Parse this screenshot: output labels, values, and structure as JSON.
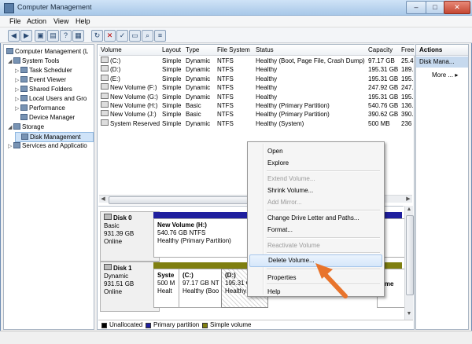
{
  "window": {
    "title": "Computer Management",
    "controls": [
      "–",
      "□",
      "✕"
    ]
  },
  "menu": [
    "File",
    "Action",
    "View",
    "Help"
  ],
  "tree": [
    {
      "label": "Computer Management (L",
      "level": 0
    },
    {
      "label": "System Tools",
      "level": 1
    },
    {
      "label": "Task Scheduler",
      "level": 2
    },
    {
      "label": "Event Viewer",
      "level": 2
    },
    {
      "label": "Shared Folders",
      "level": 2
    },
    {
      "label": "Local Users and Gro",
      "level": 2
    },
    {
      "label": "Performance",
      "level": 2
    },
    {
      "label": "Device Manager",
      "level": 2
    },
    {
      "label": "Storage",
      "level": 1
    },
    {
      "label": "Disk Management",
      "level": 2
    },
    {
      "label": "Services and Applicatio",
      "level": 1
    }
  ],
  "volumes": {
    "headers": [
      "Volume",
      "Layout",
      "Type",
      "File System",
      "Status",
      "Capacity",
      "Free"
    ],
    "rows": [
      [
        "(C:)",
        "Simple",
        "Dynamic",
        "NTFS",
        "Healthy (Boot, Page File, Crash Dump)",
        "97.17 GB",
        "25.4"
      ],
      [
        "(D:)",
        "Simple",
        "Dynamic",
        "NTFS",
        "Healthy",
        "195.31 GB",
        "189."
      ],
      [
        "(E:)",
        "Simple",
        "Dynamic",
        "NTFS",
        "Healthy",
        "195.31 GB",
        "195."
      ],
      [
        "New Volume (F:)",
        "Simple",
        "Dynamic",
        "NTFS",
        "Healthy",
        "247.92 GB",
        "247."
      ],
      [
        "New Volume (G:)",
        "Simple",
        "Dynamic",
        "NTFS",
        "Healthy",
        "195.31 GB",
        "195."
      ],
      [
        "New Volume (H:)",
        "Simple",
        "Basic",
        "NTFS",
        "Healthy (Primary Partition)",
        "540.76 GB",
        "136."
      ],
      [
        "New Volume (J:)",
        "Simple",
        "Basic",
        "NTFS",
        "Healthy (Primary Partition)",
        "390.62 GB",
        "390."
      ],
      [
        "System Reserved",
        "Simple",
        "Dynamic",
        "NTFS",
        "Healthy (System)",
        "500 MB",
        "236"
      ]
    ]
  },
  "disks": [
    {
      "name": "Disk 0",
      "type": "Basic",
      "size": "931.39 GB",
      "state": "Online",
      "partitions": [
        {
          "title": "New Volume  (H:)",
          "line2": "540.76 GB NTFS",
          "line3": "Healthy (Primary Partition)"
        }
      ]
    },
    {
      "name": "Disk 1",
      "type": "Dynamic",
      "size": "931.51 GB",
      "state": "Online",
      "partitions": [
        {
          "title": "Syste",
          "line2": "500 M",
          "line3": "Healt"
        },
        {
          "title": "(C:)",
          "line2": "97.17 GB NT",
          "line3": "Healthy (Boo"
        },
        {
          "title": "(D:)",
          "line2": "195.31 GB",
          "line3": "Healthy"
        },
        {
          "title": "ume",
          "line2": "",
          "line3": ""
        }
      ]
    }
  ],
  "legend": [
    {
      "label": "Unallocated",
      "color": "#000000"
    },
    {
      "label": "Primary partition",
      "color": "#1f1f9e"
    },
    {
      "label": "Simple volume",
      "color": "#7f7f10"
    }
  ],
  "actions": {
    "header": "Actions",
    "selected": "Disk Mana...",
    "more": "More ..."
  },
  "context_menu": [
    {
      "label": "Open",
      "enabled": true
    },
    {
      "label": "Explore",
      "enabled": true
    },
    {
      "label": "Extend Volume...",
      "enabled": false
    },
    {
      "label": "Shrink Volume...",
      "enabled": true
    },
    {
      "label": "Add Mirror...",
      "enabled": false
    },
    {
      "label": "Change Drive Letter and Paths...",
      "enabled": true
    },
    {
      "label": "Format...",
      "enabled": true
    },
    {
      "label": "Reactivate Volume",
      "enabled": false
    },
    {
      "label": "Delete Volume...",
      "enabled": true,
      "highlighted": true
    },
    {
      "label": "Properties",
      "enabled": true
    },
    {
      "label": "Help",
      "enabled": true
    }
  ],
  "colors": {
    "primary_bar": "#1f1f9e",
    "simple_bar": "#7f7f10",
    "pointer": "#e8742c"
  }
}
